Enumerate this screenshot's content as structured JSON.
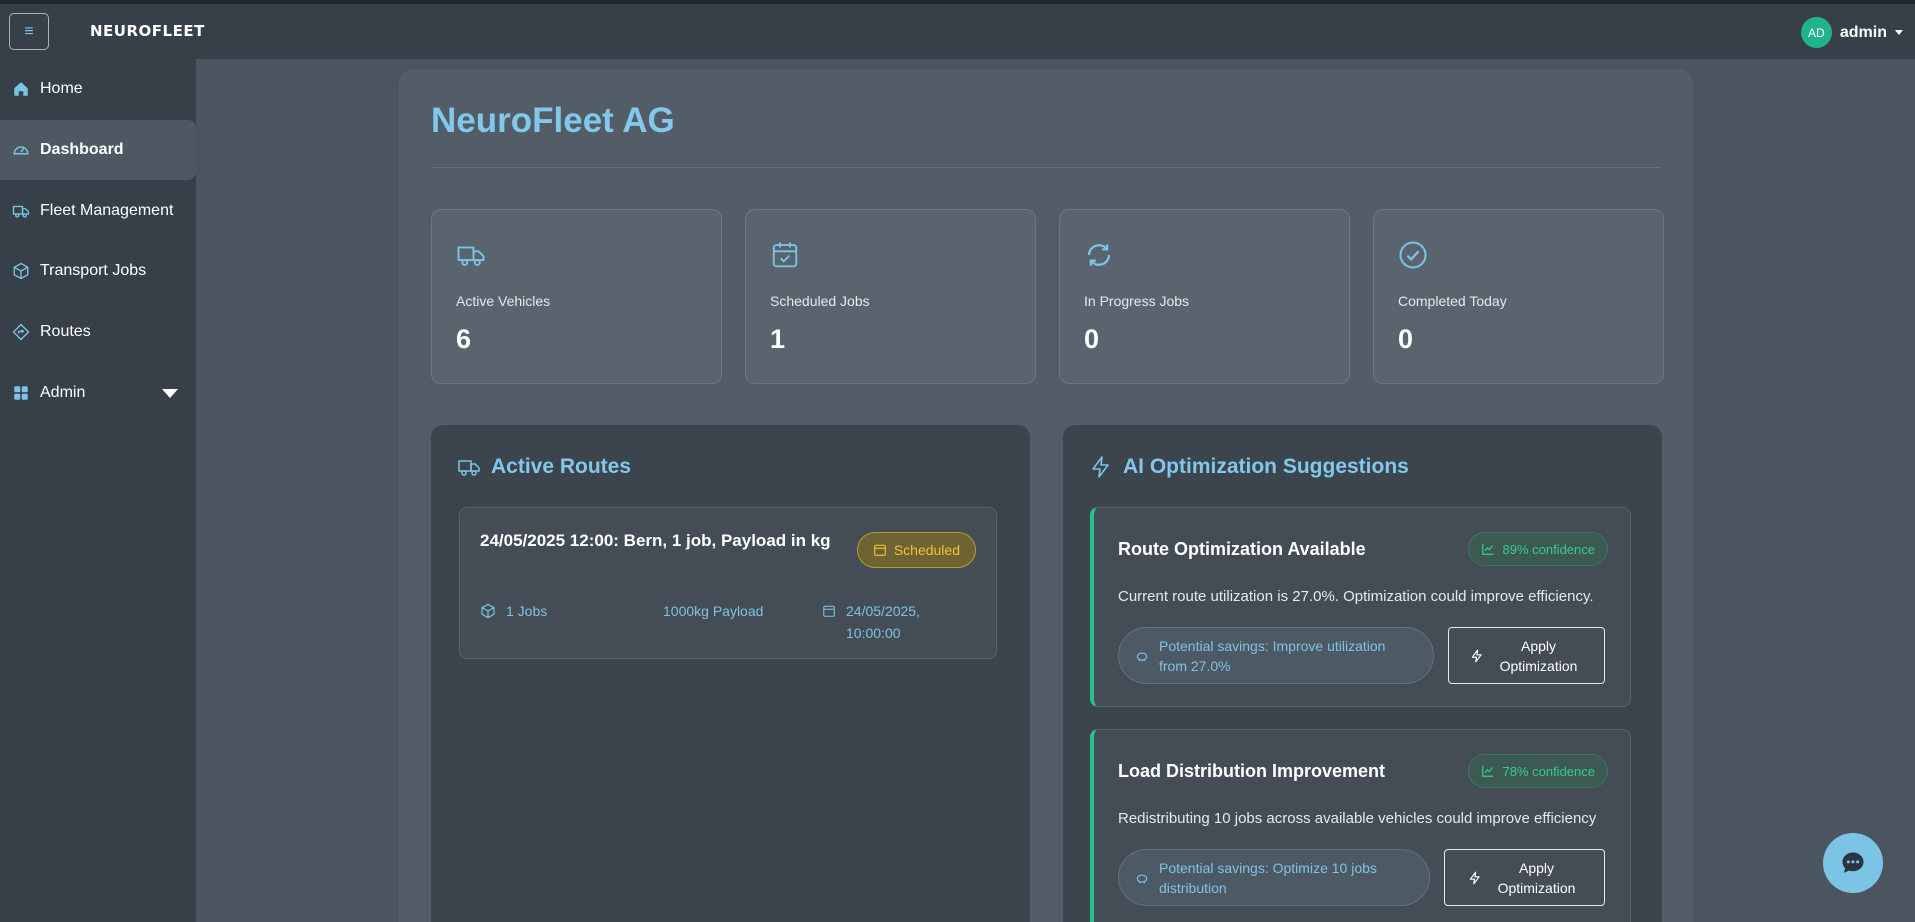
{
  "topbar": {
    "menu_icon": "≡",
    "logo": "NEUROFLEET",
    "user": {
      "initials": "AD",
      "name": "admin"
    }
  },
  "sidebar": {
    "items": [
      {
        "label": "Home",
        "icon": "home-icon"
      },
      {
        "label": "Dashboard",
        "icon": "dashboard-gauge-icon",
        "active": true
      },
      {
        "label": "Fleet Management",
        "icon": "truck-icon"
      },
      {
        "label": "Transport Jobs",
        "icon": "box-icon"
      },
      {
        "label": "Routes",
        "icon": "signpost-icon"
      },
      {
        "label": "Admin",
        "icon": "grid-icon",
        "expandable": true
      }
    ]
  },
  "main": {
    "company": "NeuroFleet AG",
    "stats": [
      {
        "label": "Active Vehicles",
        "value": "6",
        "icon": "truck-icon"
      },
      {
        "label": "Scheduled Jobs",
        "value": "1",
        "icon": "calendar-check-icon"
      },
      {
        "label": "In Progress Jobs",
        "value": "0",
        "icon": "refresh-icon"
      },
      {
        "label": "Completed Today",
        "value": "0",
        "icon": "check-circle-icon"
      }
    ],
    "active_routes": {
      "title": "Active Routes",
      "items": [
        {
          "title": "24/05/2025 12:00: Bern, 1 job, Payload in kg",
          "status": "Scheduled",
          "jobs": "1 Jobs",
          "payload": "1000kg Payload",
          "date": "24/05/2025, 10:00:00"
        }
      ]
    },
    "ai": {
      "title": "AI Optimization Suggestions",
      "suggestions": [
        {
          "title": "Route Optimization Available",
          "confidence": "89% confidence",
          "description": "Current route utilization is 27.0%. Optimization could improve efficiency.",
          "savings": "Potential savings: Improve utilization from 27.0%",
          "button": "Apply Optimization"
        },
        {
          "title": "Load Distribution Improvement",
          "confidence": "78% confidence",
          "description": "Redistributing 10 jobs across available vehicles could improve efficiency",
          "savings": "Potential savings: Optimize 10 jobs distribution",
          "button": "Apply Optimization"
        }
      ]
    }
  },
  "colors": {
    "accent": "#82c8ea",
    "success": "#2bc08a",
    "warning": "#f0c23a",
    "avatar": "#20b48a"
  }
}
